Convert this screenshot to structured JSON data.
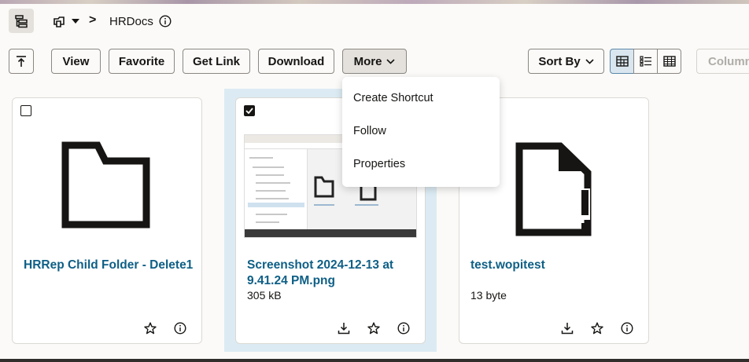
{
  "breadcrumb": {
    "separator": ">",
    "current": "HRDocs"
  },
  "toolbar": {
    "view_label": "View",
    "favorite_label": "Favorite",
    "get_link_label": "Get Link",
    "download_label": "Download",
    "more_label": "More",
    "sort_label": "Sort By",
    "columns_label": "Column"
  },
  "more_menu": {
    "items": [
      "Create Shortcut",
      "Follow",
      "Properties"
    ]
  },
  "cards": [
    {
      "name": "HRRep Child Folder - Delete1",
      "meta": "",
      "type": "folder",
      "selected": false
    },
    {
      "name": "Screenshot 2024-12-13 at 9.41.24 PM.png",
      "meta": "305 kB",
      "type": "image",
      "selected": true
    },
    {
      "name": "test.wopitest",
      "meta": "13 byte",
      "type": "unknown-file",
      "selected": false
    }
  ],
  "icons": {
    "tree": "folder-tree-icon",
    "crumb": "folders-icon",
    "info": "info-icon",
    "up": "up-level-icon",
    "chevron": "chevron-down-icon",
    "grid": "grid-view-icon",
    "list": "list-view-icon",
    "table": "table-view-icon",
    "star": "star-icon",
    "download": "download-icon",
    "file_warning": "file-warning-icon",
    "folder": "folder-icon"
  },
  "colors": {
    "link": "#0e5f86",
    "selected_bg": "#dcebf3",
    "active_seg": "#d9e6f0"
  }
}
